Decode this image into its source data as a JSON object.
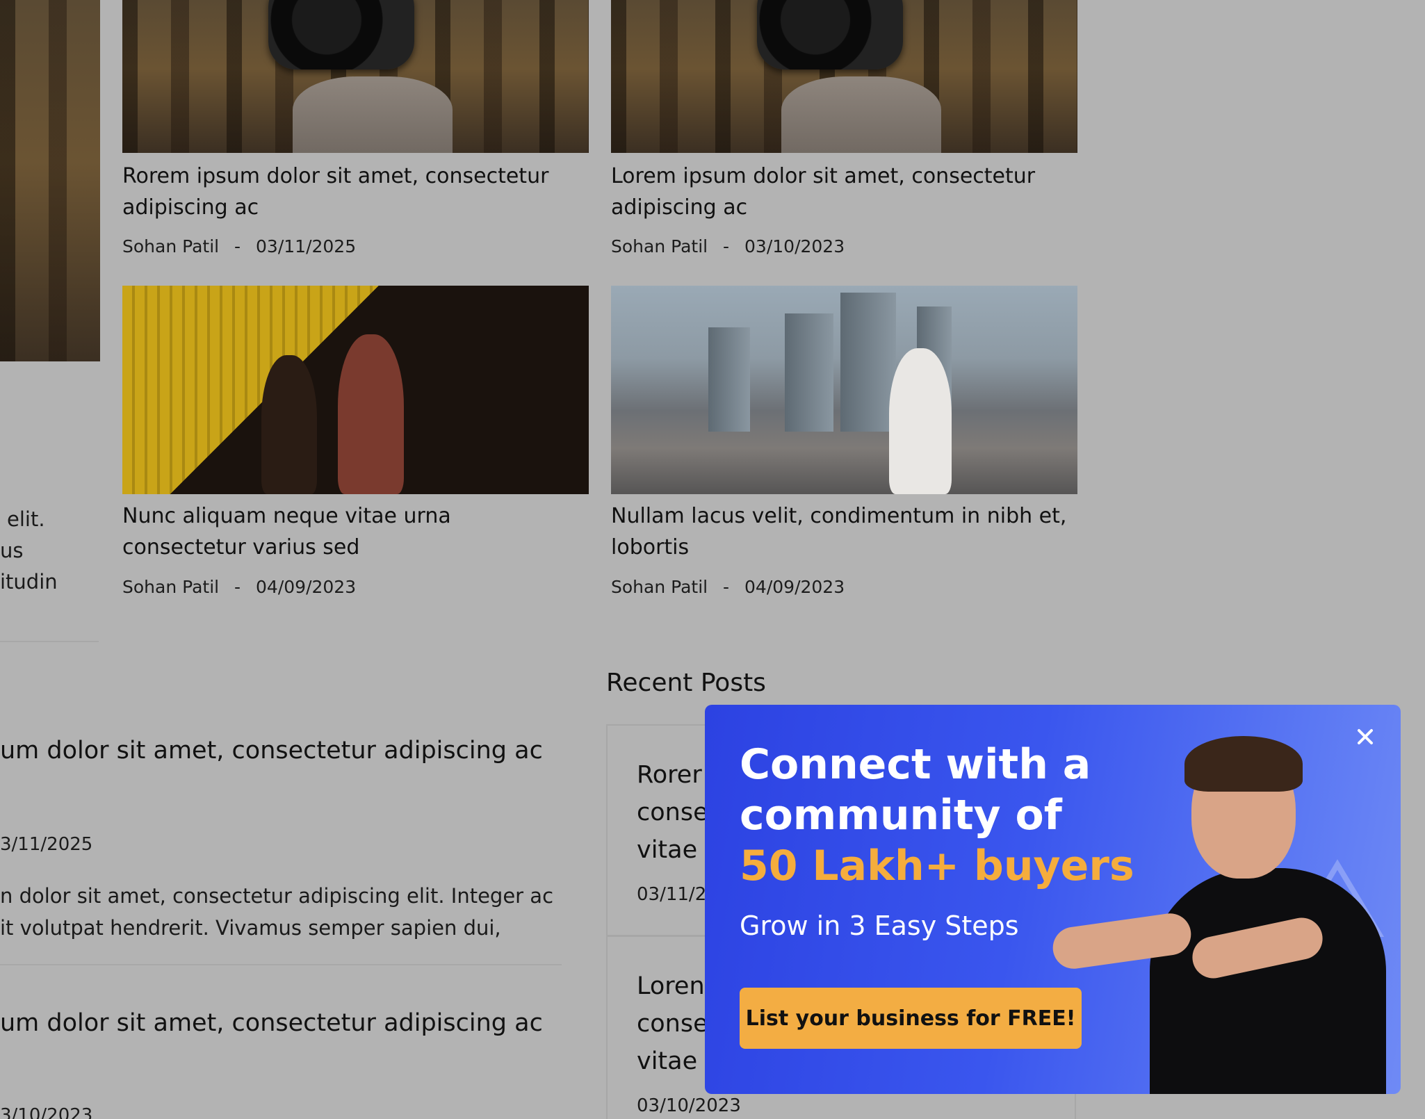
{
  "grid_posts": [
    {
      "title_l1": "Rorem ipsum dolor sit amet, consectetur",
      "title_l2": "adipiscing ac",
      "author": "Sohan Patil",
      "sep": "-",
      "date": "03/11/2025"
    },
    {
      "title_l1": "Lorem ipsum dolor sit amet, consectetur",
      "title_l2": "adipiscing ac",
      "author": "Sohan Patil",
      "sep": "-",
      "date": "03/10/2023"
    },
    {
      "title_l1": "Nunc aliquam neque vitae urna",
      "title_l2": "consectetur varius sed",
      "author": "Sohan Patil",
      "sep": "-",
      "date": "04/09/2023"
    },
    {
      "title_l1": "Nullam lacus velit, condimentum in nibh et,",
      "title_l2": "lobortis",
      "author": "Sohan Patil",
      "sep": "-",
      "date": "04/09/2023"
    }
  ],
  "left_fragment": {
    "l1": "elit.",
    "l2": "us",
    "l3": "itudin"
  },
  "lower_list": [
    {
      "title": "um dolor sit amet, consectetur adipiscing ac",
      "date": "3/11/2025",
      "text_l1": "n dolor sit amet, consectetur adipiscing elit. Integer ac",
      "text_l2": "it volutpat hendrerit. Vivamus semper sapien dui,"
    },
    {
      "title": "um dolor sit amet, consectetur adipiscing ac",
      "date": "3/10/2023"
    }
  ],
  "recent": {
    "heading": "Recent Posts",
    "cards": [
      {
        "l1": "Rorer",
        "l2": "conse",
        "l3": "vitae v",
        "date": "03/11/20"
      },
      {
        "l1": "Loren",
        "l2": "conse",
        "l3": "vitae v",
        "date": "03/10/2023"
      }
    ]
  },
  "popup": {
    "headline_l1": "Connect with a",
    "headline_l2": "community of",
    "headline_accent": "50 Lakh+ buyers",
    "subtitle": "Grow in 3 Easy Steps",
    "cta_label": "List your business for FREE!",
    "close_icon": "close-icon",
    "accent_color": "#f5ad3d",
    "cta_color": "#f3ad43"
  }
}
